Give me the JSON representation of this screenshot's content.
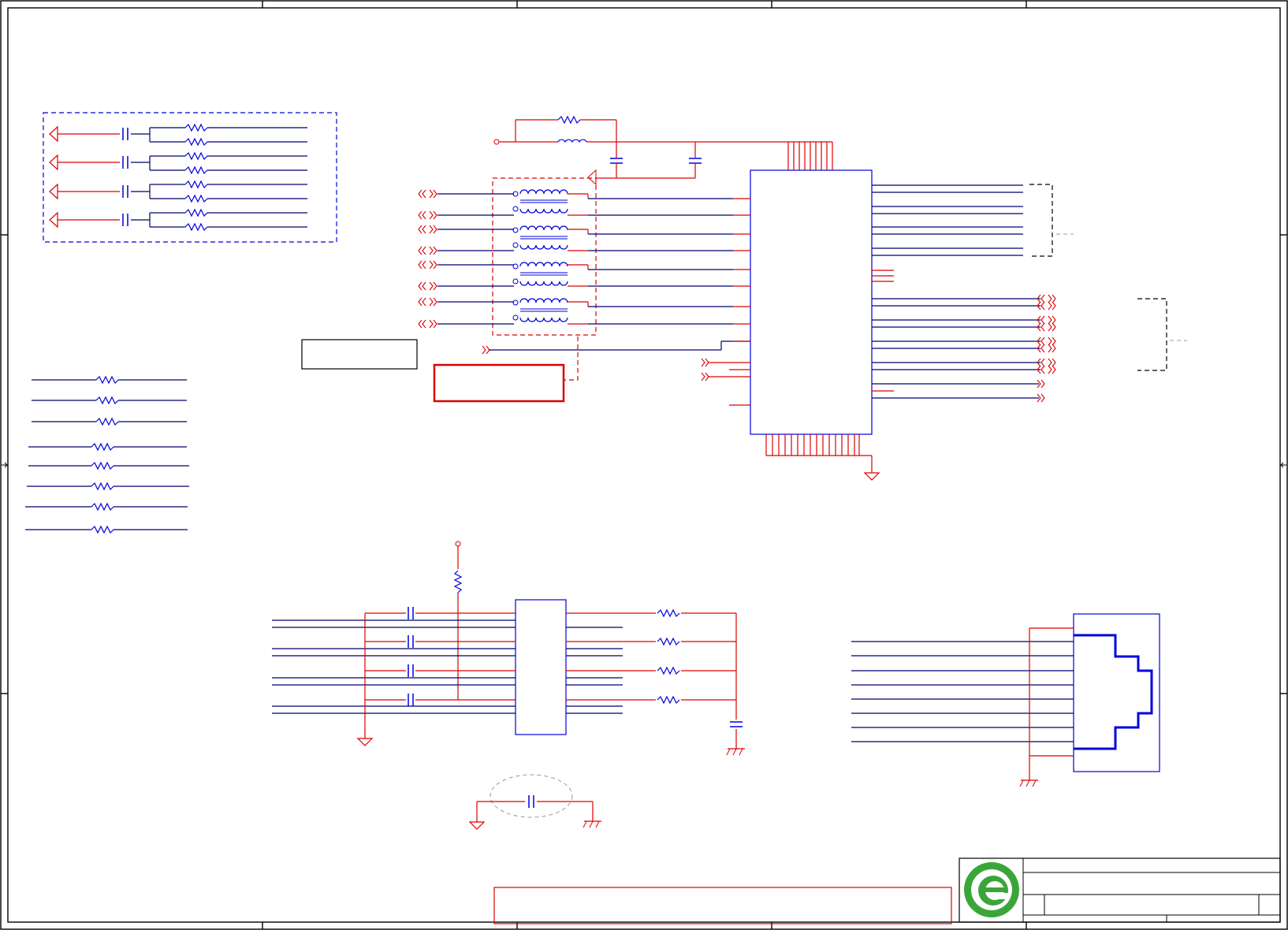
{
  "drawing": {
    "title_block": {
      "logo": "company-logo-icon"
    },
    "colors": {
      "wire": "#dd0000",
      "net": "#00006e",
      "component": "#0000dd",
      "logo": "#3aa63a"
    }
  },
  "icons": [
    "resistor-icon",
    "capacitor-icon",
    "inductor-icon",
    "transformer-icon",
    "ground-icon",
    "chassis-ground-icon",
    "off-page-connector-icon",
    "rj45-jack-icon"
  ]
}
